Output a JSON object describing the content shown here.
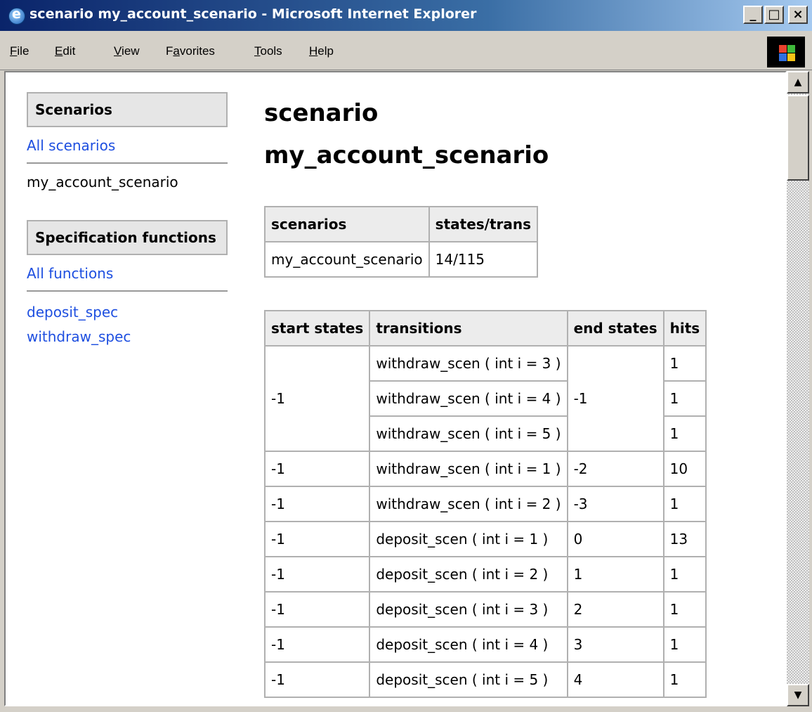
{
  "window": {
    "title": "scenario my_account_scenario - Microsoft Internet Explorer",
    "controls": [
      "_",
      "□",
      "×"
    ]
  },
  "menubar": {
    "items": [
      {
        "u": "F",
        "rest": "ile"
      },
      {
        "u": "E",
        "rest": "dit"
      },
      {
        "u": "V",
        "rest": "iew"
      },
      {
        "pre": "F",
        "u": "a",
        "rest": "vorites"
      },
      {
        "u": "T",
        "rest": "ools"
      },
      {
        "u": "H",
        "rest": "elp"
      }
    ]
  },
  "sidebar": {
    "scenarios_header": "Scenarios",
    "all_scenarios_link": "All scenarios",
    "current_scenario": "my_account_scenario",
    "functions_header": "Specification functions",
    "all_functions_link": "All functions",
    "functions": [
      "deposit_spec",
      "withdraw_spec"
    ]
  },
  "main": {
    "title_line1": "scenario",
    "title_line2": "my_account_scenario",
    "summary_table": {
      "headers": [
        "scenarios",
        "states/trans"
      ],
      "row": [
        "my_account_scenario",
        "14/115"
      ]
    },
    "transitions_table": {
      "headers": [
        "start states",
        "transitions",
        "end states",
        "hits"
      ],
      "group": {
        "start": "-1",
        "end": "-1",
        "rows": [
          {
            "transition": "withdraw_scen ( int i = 3 )",
            "hits": "1"
          },
          {
            "transition": "withdraw_scen ( int i = 4 )",
            "hits": "1"
          },
          {
            "transition": "withdraw_scen ( int i = 5 )",
            "hits": "1"
          }
        ]
      },
      "rows": [
        {
          "start": "-1",
          "transition": "withdraw_scen ( int i = 1 )",
          "end": "-2",
          "hits": "10"
        },
        {
          "start": "-1",
          "transition": "withdraw_scen ( int i = 2 )",
          "end": "-3",
          "hits": "1"
        },
        {
          "start": "-1",
          "transition": "deposit_scen ( int i = 1 )",
          "end": "0",
          "hits": "13"
        },
        {
          "start": "-1",
          "transition": "deposit_scen ( int i = 2 )",
          "end": "1",
          "hits": "1"
        },
        {
          "start": "-1",
          "transition": "deposit_scen ( int i = 3 )",
          "end": "2",
          "hits": "1"
        },
        {
          "start": "-1",
          "transition": "deposit_scen ( int i = 4 )",
          "end": "3",
          "hits": "1"
        },
        {
          "start": "-1",
          "transition": "deposit_scen ( int i = 5 )",
          "end": "4",
          "hits": "1"
        }
      ]
    }
  },
  "scrollbar": {
    "up_glyph": "▲",
    "down_glyph": "▼"
  }
}
